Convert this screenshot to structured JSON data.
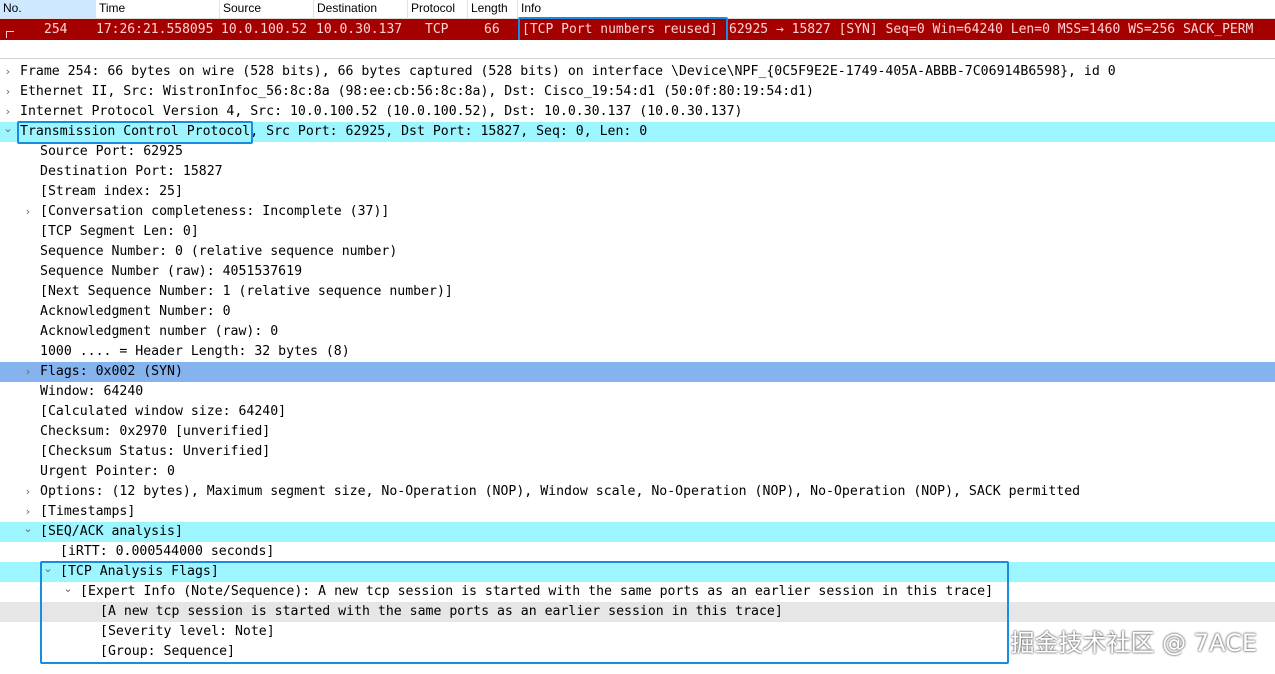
{
  "packet_list": {
    "columns": [
      "No.",
      "Time",
      "Source",
      "Destination",
      "Protocol",
      "Length",
      "Info"
    ],
    "row": {
      "no": "254",
      "time": "17:26:21.558095",
      "source": "10.0.100.52",
      "destination": "10.0.30.137",
      "protocol": "TCP",
      "length": "66",
      "info_tag": "[TCP Port numbers reused]",
      "info_rest": "62925 → 15827 [SYN] Seq=0 Win=64240 Len=0 MSS=1460 WS=256 SACK_PERM"
    },
    "row_color": "#a40000"
  },
  "tree": [
    {
      "text": "Frame 254: 66 bytes on wire (528 bits), 66 bytes captured (528 bits) on interface \\Device\\NPF_{0C5F9E2E-1749-405A-ABBB-7C06914B6598}, id 0",
      "arrow": "collapsed"
    },
    {
      "text": "Ethernet II, Src: WistronInfoc_56:8c:8a (98:ee:cb:56:8c:8a), Dst: Cisco_19:54:d1 (50:0f:80:19:54:d1)",
      "arrow": "collapsed"
    },
    {
      "text": "Internet Protocol Version 4, Src: 10.0.100.52 (10.0.100.52), Dst: 10.0.30.137 (10.0.30.137)",
      "arrow": "collapsed"
    },
    {
      "text": "Transmission Control Protocol, Src Port: 62925, Dst Port: 15827, Seq: 0, Len: 0",
      "arrow": "expanded",
      "highlight": "cyan"
    },
    {
      "text": "Source Port: 62925"
    },
    {
      "text": "Destination Port: 15827"
    },
    {
      "text": "[Stream index: 25]"
    },
    {
      "text": "[Conversation completeness: Incomplete (37)]",
      "arrow": "collapsed"
    },
    {
      "text": "[TCP Segment Len: 0]"
    },
    {
      "text": "Sequence Number: 0    (relative sequence number)"
    },
    {
      "text": "Sequence Number (raw): 4051537619"
    },
    {
      "text": "[Next Sequence Number: 1    (relative sequence number)]"
    },
    {
      "text": "Acknowledgment Number: 0"
    },
    {
      "text": "Acknowledgment number (raw): 0"
    },
    {
      "text": "1000 .... = Header Length: 32 bytes (8)"
    },
    {
      "text": "Flags: 0x002 (SYN)",
      "arrow": "collapsed",
      "highlight": "blue"
    },
    {
      "text": "Window: 64240"
    },
    {
      "text": "[Calculated window size: 64240]"
    },
    {
      "text": "Checksum: 0x2970 [unverified]"
    },
    {
      "text": "[Checksum Status: Unverified]"
    },
    {
      "text": "Urgent Pointer: 0"
    },
    {
      "text": "Options: (12 bytes), Maximum segment size, No-Operation (NOP), Window scale, No-Operation (NOP), No-Operation (NOP), SACK permitted",
      "arrow": "collapsed"
    },
    {
      "text": "[Timestamps]",
      "arrow": "collapsed"
    },
    {
      "text": "[SEQ/ACK analysis]",
      "arrow": "expanded",
      "highlight": "cyan"
    },
    {
      "text": "[iRTT: 0.000544000 seconds]"
    },
    {
      "text": "[TCP Analysis Flags]",
      "arrow": "expanded",
      "highlight": "cyan"
    },
    {
      "text": "[Expert Info (Note/Sequence): A new tcp session is started with the same ports as an earlier session in this trace]",
      "arrow": "expanded"
    },
    {
      "text": "[A new tcp session is started with the same ports as an earlier session in this trace]",
      "highlight": "grey"
    },
    {
      "text": "[Severity level: Note]"
    },
    {
      "text": "[Group: Sequence]"
    }
  ],
  "watermark": "掘金技术社区 @ 7ACE",
  "colors": {
    "cyan_highlight": "#9cf5ff",
    "blue_highlight": "#84b3ee",
    "annotation_box": "#1a8ce0"
  }
}
